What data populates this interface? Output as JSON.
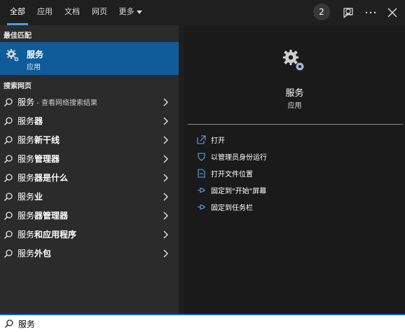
{
  "tabs": [
    {
      "label": "全部"
    },
    {
      "label": "应用"
    },
    {
      "label": "文档"
    },
    {
      "label": "网页"
    },
    {
      "label": "更多"
    }
  ],
  "top_right": {
    "badge": "2"
  },
  "left": {
    "best_match_label": "最佳匹配",
    "best_match": {
      "title": "服务",
      "subtitle": "应用"
    },
    "web_label": "搜索网页",
    "results": [
      {
        "query": "服务",
        "hint": " - 查看网络搜索结果"
      },
      {
        "prefix": "服务",
        "suffix": "器"
      },
      {
        "prefix": "服务",
        "suffix": "新干线"
      },
      {
        "prefix": "服务",
        "suffix": "管理器"
      },
      {
        "prefix": "服务",
        "suffix": "器是什么"
      },
      {
        "prefix": "服务",
        "suffix": "业"
      },
      {
        "prefix": "服务",
        "suffix": "器管理器"
      },
      {
        "prefix": "服务",
        "suffix": "和应用程序"
      },
      {
        "prefix": "服务",
        "suffix": "外包"
      }
    ]
  },
  "right": {
    "title": "服务",
    "subtitle": "应用",
    "actions": [
      {
        "label": "打开"
      },
      {
        "label": "以管理员身份运行"
      },
      {
        "label": "打开文件位置"
      },
      {
        "label": "固定到\"开始\"屏幕"
      },
      {
        "label": "固定到任务栏"
      }
    ]
  },
  "search": {
    "value": "服务"
  },
  "colors": {
    "accent": "#0f5c99",
    "tab_underline": "#4a9fe6",
    "search_border": "#0a64c2"
  }
}
